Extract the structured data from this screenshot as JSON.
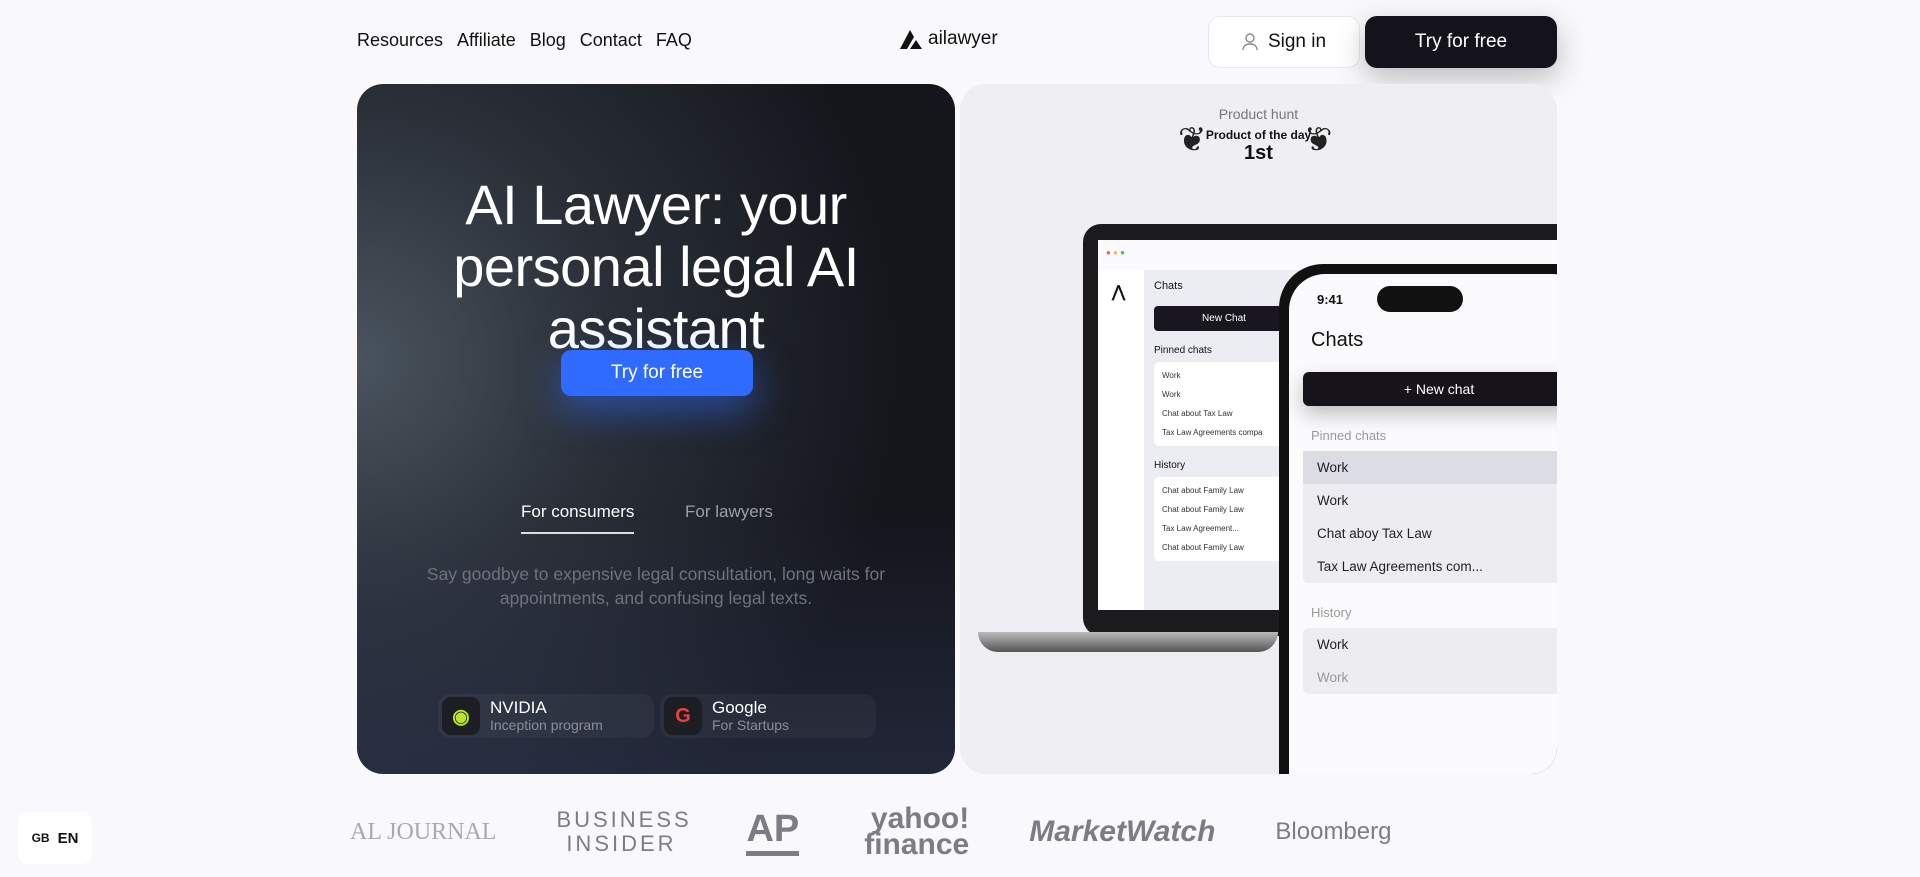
{
  "nav": {
    "links": [
      "Resources",
      "Affiliate",
      "Blog",
      "Contact",
      "FAQ"
    ],
    "logo": "ailawyer",
    "sign_in": "Sign in",
    "try_free": "Try for free"
  },
  "hero": {
    "title": "AI Lawyer: your personal legal AI assistant",
    "cta": "Try for free",
    "tabs": [
      "For consumers",
      "For lawyers"
    ],
    "active_tab": "For consumers",
    "description": "Say goodbye to expensive legal consultation, long waits for appointments, and confusing legal texts.",
    "badges": [
      {
        "title": "NVIDIA",
        "subtitle": "Inception program"
      },
      {
        "title": "Google",
        "subtitle": "For Startups"
      }
    ],
    "accent": "#2f6bff"
  },
  "product_hunt": {
    "label": "Product hunt",
    "award": "Product of the day",
    "rank": "1st"
  },
  "laptop": {
    "title": "Chats",
    "new_chat": "New Chat",
    "pinned_label": "Pinned chats",
    "pinned": [
      "Work",
      "Work",
      "Chat about Tax Law",
      "Tax Law Agreements compa"
    ],
    "history_label": "History",
    "history": [
      "Chat about Family Law",
      "Chat about Family Law",
      "Tax Law Agreement...",
      "Chat about Family Law"
    ]
  },
  "phone": {
    "time": "9:41",
    "title": "Chats",
    "new_chat": "+  New chat",
    "pinned_label": "Pinned chats",
    "pinned": [
      "Work",
      "Work",
      "Chat aboy Tax Law",
      "Tax Law Agreements com..."
    ],
    "history_label": "History",
    "history": [
      "Work",
      "Work"
    ]
  },
  "media": [
    "AL JOURNAL",
    "BUSINESS INSIDER",
    "AP",
    "yahoo! finance",
    "MarketWatch",
    "Bloomberg"
  ],
  "language": {
    "flag": "GB",
    "code": "EN"
  }
}
